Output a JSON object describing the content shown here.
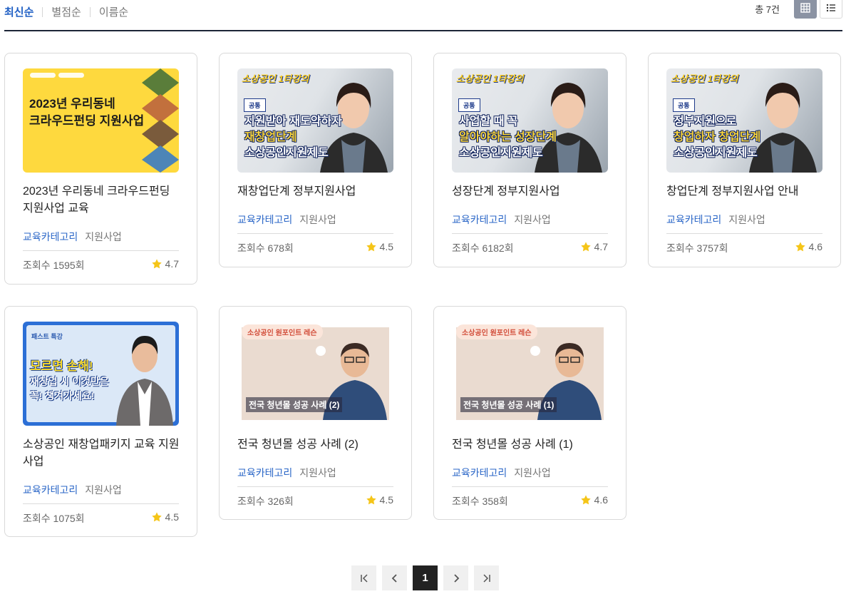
{
  "sort": {
    "tabs": [
      "최신순",
      "별점순",
      "이름순"
    ],
    "active": "최신순"
  },
  "total_label": "총 7건",
  "view_modes": [
    "grid-view-icon",
    "list-view-icon"
  ],
  "courses": [
    {
      "title": "2023년 우리동네 크라우드펀딩 지원사업 교육",
      "thumb_text": [
        "2023년 우리동네",
        "크라우드펀딩 지원사업"
      ],
      "category": "교육카테고리",
      "subcategory": "지원사업",
      "views": "조회수 1595회",
      "rating": "4.7"
    },
    {
      "title": "재창업단계 정부지원사업",
      "thumb_brand": "소상공인 1타강의",
      "thumb_tag": "공통",
      "thumb_text": [
        "지원받아 재도약하자",
        "재창업단계",
        "소상공인지원제도"
      ],
      "category": "교육카테고리",
      "subcategory": "지원사업",
      "views": "조회수 678회",
      "rating": "4.5"
    },
    {
      "title": "성장단계 정부지원사업",
      "thumb_brand": "소상공인 1타강의",
      "thumb_tag": "공통",
      "thumb_text": [
        "사업할 때 꼭",
        "알아야하는 성장단계",
        "소상공인지원제도"
      ],
      "category": "교육카테고리",
      "subcategory": "지원사업",
      "views": "조회수 6182회",
      "rating": "4.7"
    },
    {
      "title": "창업단계 정부지원사업 안내",
      "thumb_brand": "소상공인 1타강의",
      "thumb_tag": "공통",
      "thumb_text": [
        "정부지원으로",
        "창업하자 창업단계",
        "소상공인지원제도"
      ],
      "category": "교육카테고리",
      "subcategory": "지원사업",
      "views": "조회수 3757회",
      "rating": "4.6"
    },
    {
      "title": "소상공인 재창업패키지 교육 지원사업",
      "thumb_brand": "패스트 특강",
      "thumb_text": [
        "모르면 손해!",
        "재창업 시 이것만은",
        "꼭! 챙겨가세요!"
      ],
      "category": "교육카테고리",
      "subcategory": "지원사업",
      "views": "조회수 1075회",
      "rating": "4.5"
    },
    {
      "title": "전국 청년몰 성공 사례 (2)",
      "thumb_brand": "소상공인 원포인트 레슨",
      "thumb_text": [
        "전국 청년몰 성공 사례 (2)"
      ],
      "category": "교육카테고리",
      "subcategory": "지원사업",
      "views": "조회수 326회",
      "rating": "4.5"
    },
    {
      "title": "전국 청년몰 성공 사례 (1)",
      "thumb_brand": "소상공인 원포인트 레슨",
      "thumb_text": [
        "전국 청년몰 성공 사례 (1)"
      ],
      "category": "교육카테고리",
      "subcategory": "지원사업",
      "views": "조회수 358회",
      "rating": "4.6"
    }
  ],
  "pagination": {
    "first": "first-page-icon",
    "prev": "prev-page-icon",
    "current": "1",
    "next": "next-page-icon",
    "last": "last-page-icon"
  },
  "colors": {
    "accent": "#1f5fc4",
    "star": "#f5c518",
    "active_page": "#222222"
  }
}
